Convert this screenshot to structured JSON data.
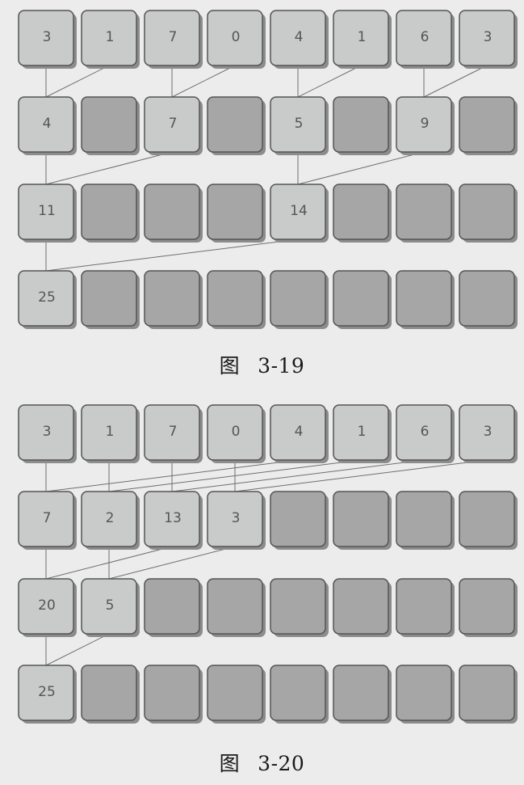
{
  "figures": [
    {
      "id": "fig-3-19",
      "caption_prefix": "图",
      "caption_number": "3-19",
      "rows": [
        [
          "3",
          "1",
          "7",
          "0",
          "4",
          "1",
          "6",
          "3"
        ],
        [
          "4",
          "",
          "7",
          "",
          "5",
          "",
          "9",
          ""
        ],
        [
          "11",
          "",
          "",
          "",
          "14",
          "",
          "",
          ""
        ],
        [
          "25",
          "",
          "",
          "",
          "",
          "",
          "",
          ""
        ]
      ],
      "edges": [
        [
          0,
          0,
          1,
          0
        ],
        [
          0,
          1,
          1,
          0
        ],
        [
          0,
          2,
          1,
          2
        ],
        [
          0,
          3,
          1,
          2
        ],
        [
          0,
          4,
          1,
          4
        ],
        [
          0,
          5,
          1,
          4
        ],
        [
          0,
          6,
          1,
          6
        ],
        [
          0,
          7,
          1,
          6
        ],
        [
          1,
          0,
          2,
          0
        ],
        [
          1,
          2,
          2,
          0
        ],
        [
          1,
          4,
          2,
          4
        ],
        [
          1,
          6,
          2,
          4
        ],
        [
          2,
          0,
          3,
          0
        ],
        [
          2,
          4,
          3,
          0
        ]
      ]
    },
    {
      "id": "fig-3-20",
      "caption_prefix": "图",
      "caption_number": "3-20",
      "rows": [
        [
          "3",
          "1",
          "7",
          "0",
          "4",
          "1",
          "6",
          "3"
        ],
        [
          "7",
          "2",
          "13",
          "3",
          "",
          "",
          "",
          ""
        ],
        [
          "20",
          "5",
          "",
          "",
          "",
          "",
          "",
          ""
        ],
        [
          "25",
          "",
          "",
          "",
          "",
          "",
          "",
          ""
        ]
      ],
      "edges": [
        [
          0,
          0,
          1,
          0
        ],
        [
          0,
          4,
          1,
          0
        ],
        [
          0,
          1,
          1,
          1
        ],
        [
          0,
          5,
          1,
          1
        ],
        [
          0,
          2,
          1,
          2
        ],
        [
          0,
          6,
          1,
          2
        ],
        [
          0,
          3,
          1,
          3
        ],
        [
          0,
          7,
          1,
          3
        ],
        [
          1,
          0,
          2,
          0
        ],
        [
          1,
          2,
          2,
          0
        ],
        [
          1,
          1,
          2,
          1
        ],
        [
          1,
          3,
          2,
          1
        ],
        [
          2,
          0,
          3,
          0
        ],
        [
          2,
          1,
          3,
          0
        ]
      ]
    }
  ],
  "colors": {
    "background": "#ececec",
    "filled_cell": "#c9cbcb",
    "empty_cell": "#a6a6a6",
    "cell_border": "#555555",
    "connector": "#6e6e6e"
  }
}
